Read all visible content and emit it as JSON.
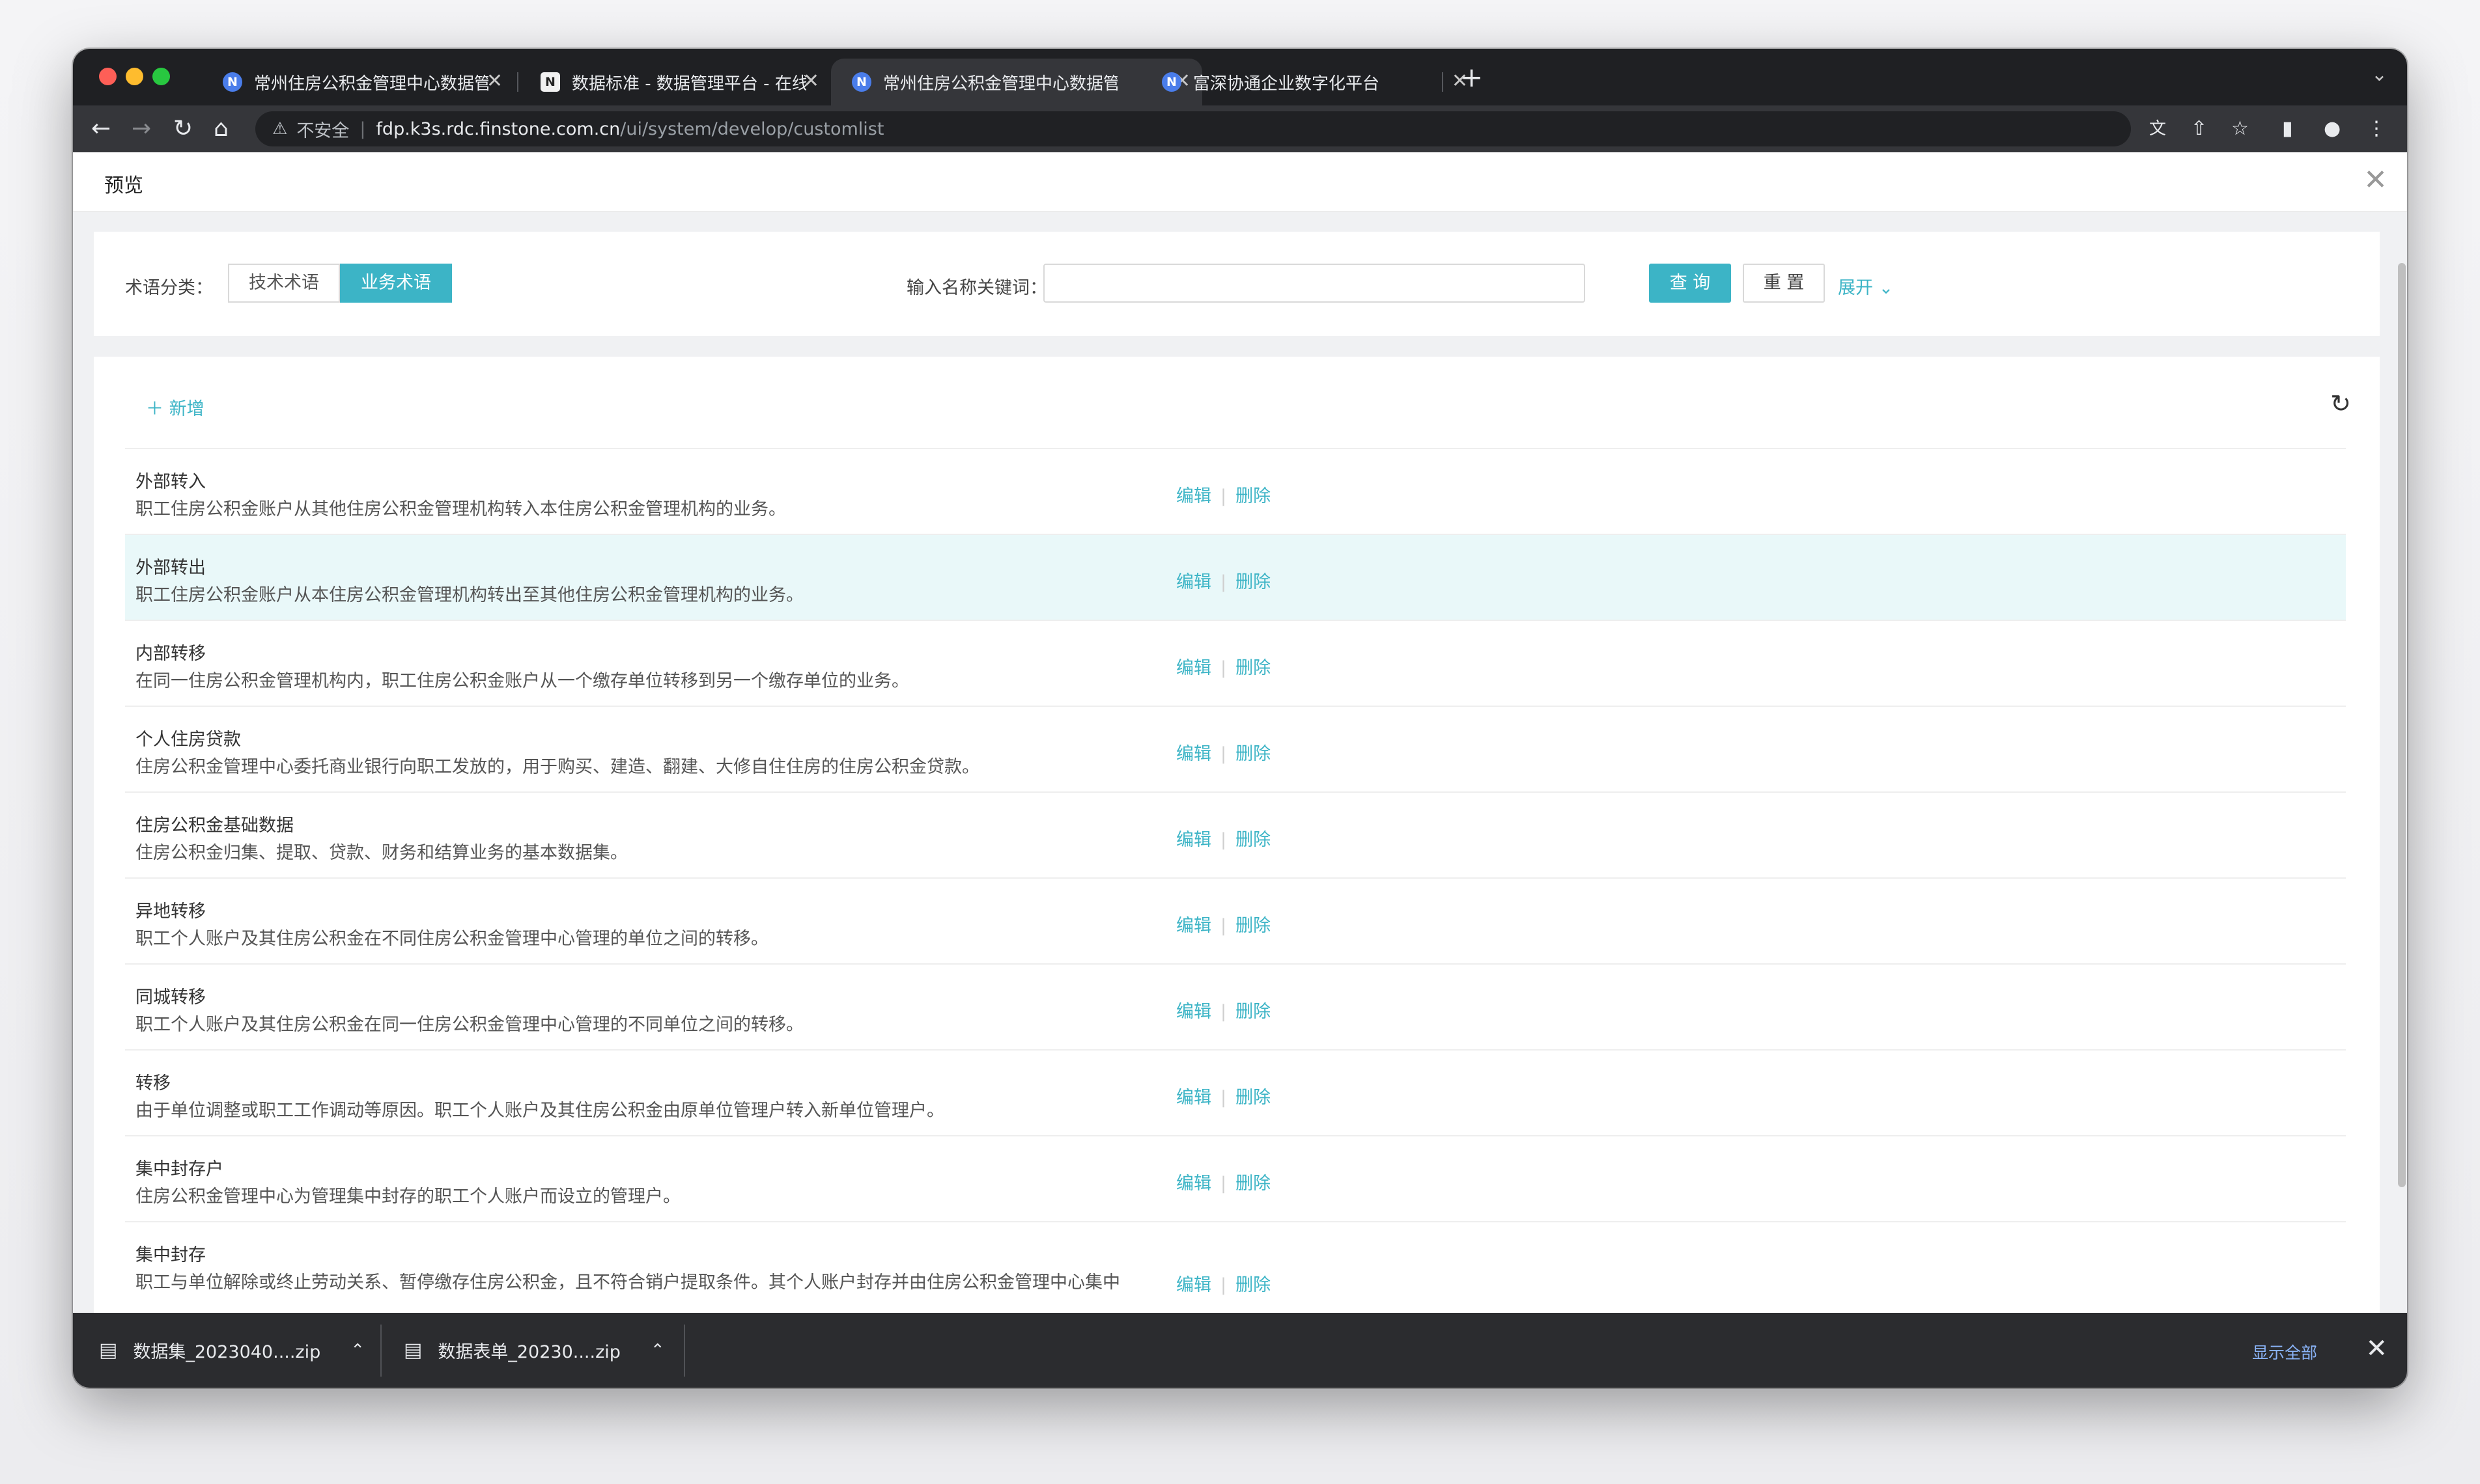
{
  "browser": {
    "tabs": [
      {
        "favicon": "N",
        "title": "常州住房公积金管理中心数据管理",
        "active": false
      },
      {
        "favicon": "N",
        "title": "数据标准 - 数据管理平台 - 在线文档",
        "active": false
      },
      {
        "favicon": "N",
        "title": "常州住房公积金管理中心数据管理",
        "active": true
      },
      {
        "favicon": "N",
        "title": "富深协通企业数字化平台",
        "active": false
      }
    ],
    "security_label": "不安全",
    "url_host": "fdp.k3s.rdc.finstone.com.cn",
    "url_path": "/ui/system/develop/customlist"
  },
  "modal": {
    "title": "预览"
  },
  "filter": {
    "category_label": "术语分类：",
    "category_options": [
      "技术术语",
      "业务术语"
    ],
    "selected": "业务术语",
    "keyword_label": "输入名称关键词：",
    "keyword_value": "",
    "query_label": "查 询",
    "reset_label": "重 置",
    "expand_label": "展开"
  },
  "list": {
    "add_label": "新增",
    "edit_label": "编辑",
    "delete_label": "删除",
    "rows": [
      {
        "name": "外部转入",
        "desc": "职工住房公积金账户从其他住房公积金管理机构转入本住房公积金管理机构的业务。"
      },
      {
        "name": "外部转出",
        "desc": "职工住房公积金账户从本住房公积金管理机构转出至其他住房公积金管理机构的业务。"
      },
      {
        "name": "内部转移",
        "desc": "在同一住房公积金管理机构内，职工住房公积金账户从一个缴存单位转移到另一个缴存单位的业务。"
      },
      {
        "name": "个人住房贷款",
        "desc": "住房公积金管理中心委托商业银行向职工发放的，用于购买、建造、翻建、大修自住住房的住房公积金贷款。"
      },
      {
        "name": "住房公积金基础数据",
        "desc": "住房公积金归集、提取、贷款、财务和结算业务的基本数据集。"
      },
      {
        "name": "异地转移",
        "desc": "职工个人账户及其住房公积金在不同住房公积金管理中心管理的单位之间的转移。"
      },
      {
        "name": "同城转移",
        "desc": "职工个人账户及其住房公积金在同一住房公积金管理中心管理的不同单位之间的转移。"
      },
      {
        "name": "转移",
        "desc": "由于单位调整或职工工作调动等原因。职工个人账户及其住房公积金由原单位管理户转入新单位管理户。"
      },
      {
        "name": "集中封存户",
        "desc": "住房公积金管理中心为管理集中封存的职工个人账户而设立的管理户。"
      },
      {
        "name": "集中封存",
        "desc": "职工与单位解除或终止劳动关系、暂停缴存住房公积金，且不符合销户提取条件。其个人账户封存并由住房公积金管理中心集中"
      }
    ]
  },
  "downloads": {
    "items": [
      "数据集_2023040....zip",
      "数据表单_20230....zip"
    ],
    "show_all_label": "显示全部"
  }
}
